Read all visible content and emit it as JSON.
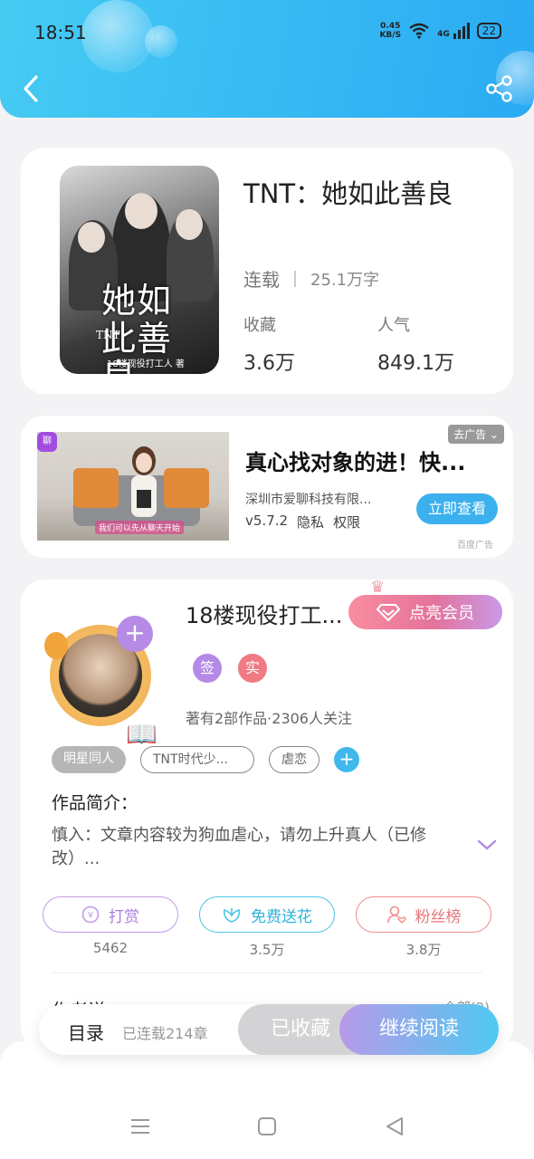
{
  "status_bar": {
    "time": "18:51",
    "net_speed_value": "0.45",
    "net_speed_unit": "KB/S",
    "network": "4G",
    "battery": "22"
  },
  "header": {
    "back_icon": "chevron-left-icon",
    "share_icon": "share-icon",
    "accent": "#2aaaf3"
  },
  "book": {
    "cover_title": "她如此善良",
    "cover_tnt": "TNT",
    "cover_author": "18楼现役打工人 著",
    "title": "TNT：她如此善良",
    "status": "连载",
    "words": "25.1万字",
    "favorites_label": "收藏",
    "favorites_value": "3.6万",
    "popularity_label": "人气",
    "popularity_value": "849.1万"
  },
  "ad": {
    "close_label": "去广告",
    "title": "真心找对象的进！快...",
    "company": "深圳市爱聊科技有限...",
    "version": "v5.7.2",
    "privacy": "隐私",
    "permission": "权限",
    "cta": "立即查看",
    "source": "百度广告",
    "image_caption": "我们可以先从聊天开始",
    "logo_text": "聊"
  },
  "author": {
    "name": "18楼现役打工...",
    "vip_label": "点亮会员",
    "badge_sign": "签",
    "badge_real": "实",
    "stats": "著有2部作品·2306人关注",
    "tags": [
      "明星同人",
      "TNT时代少...",
      "虐恋"
    ],
    "intro_label": "作品简介：",
    "intro_text": "慎入：文章内容较为狗血虐心，请勿上升真人（已修改）...",
    "reward_label": "打赏",
    "reward_count": "5462",
    "flower_label": "免费送花",
    "flower_count": "3.5万",
    "fans_label": "粉丝榜",
    "fans_count": "3.8万",
    "author_says": "作者说",
    "all_link": "全部(2)"
  },
  "bottom_bar": {
    "toc_label": "目录",
    "chapter_count": "已连载214章",
    "collected_label": "已收藏",
    "read_label": "继续阅读"
  }
}
